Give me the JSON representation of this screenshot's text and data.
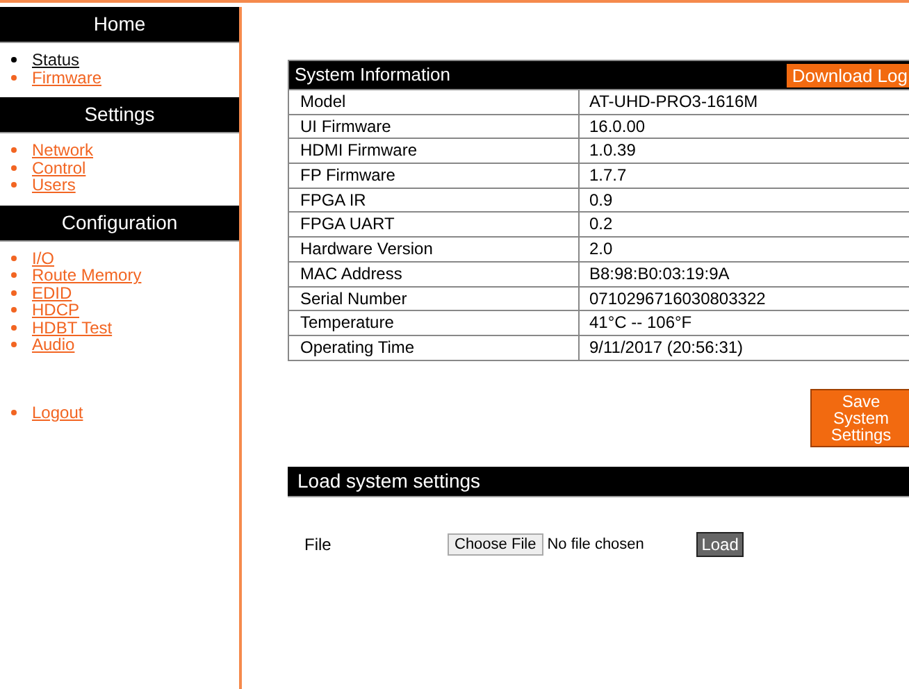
{
  "sidebar": {
    "sections": [
      {
        "title": "Home",
        "items": [
          {
            "label": "Status",
            "selected": true
          },
          {
            "label": "Firmware",
            "selected": false
          }
        ]
      },
      {
        "title": "Settings",
        "items": [
          {
            "label": "Network",
            "selected": false
          },
          {
            "label": "Control",
            "selected": false
          },
          {
            "label": "Users",
            "selected": false
          }
        ]
      },
      {
        "title": "Configuration",
        "items": [
          {
            "label": "I/O",
            "selected": false
          },
          {
            "label": "Route Memory",
            "selected": false
          },
          {
            "label": "EDID",
            "selected": false
          },
          {
            "label": "HDCP",
            "selected": false
          },
          {
            "label": "HDBT Test",
            "selected": false
          },
          {
            "label": "Audio",
            "selected": false
          }
        ]
      }
    ],
    "logout": "Logout"
  },
  "system_info": {
    "title": "System Information",
    "download_button": "Download Log",
    "rows": [
      {
        "label": "Model",
        "value": "AT-UHD-PRO3-1616M"
      },
      {
        "label": "UI Firmware",
        "value": "16.0.00"
      },
      {
        "label": "HDMI Firmware",
        "value": "1.0.39"
      },
      {
        "label": "FP Firmware",
        "value": "1.7.7"
      },
      {
        "label": "FPGA IR",
        "value": "0.9"
      },
      {
        "label": "FPGA UART",
        "value": "0.2"
      },
      {
        "label": "Hardware Version",
        "value": "2.0"
      },
      {
        "label": "MAC Address",
        "value": "B8:98:B0:03:19:9A"
      },
      {
        "label": "Serial Number",
        "value": "0710296716030803322"
      },
      {
        "label": "Temperature",
        "value": "41°C -- 106°F"
      },
      {
        "label": "Operating Time",
        "value": "9/11/2017 (20:56:31)"
      }
    ]
  },
  "save_button": "Save System Settings",
  "load_settings": {
    "title": "Load system settings",
    "file_label": "File",
    "choose_button": "Choose File",
    "file_status": "No file chosen",
    "load_button": "Load"
  }
}
